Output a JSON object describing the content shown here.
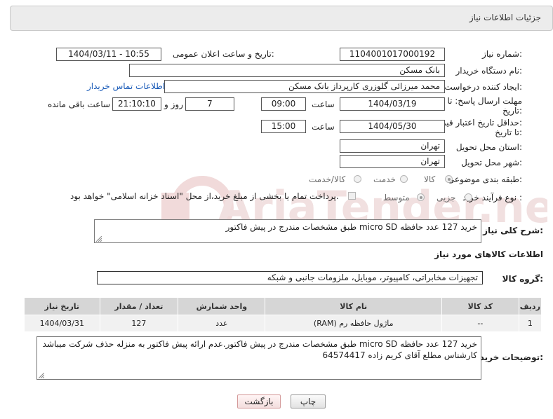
{
  "header": {
    "title": "جزئیات اطلاعات نیاز"
  },
  "fields": {
    "need_number_label": "شماره نیاز:",
    "need_number": "1104001017000192",
    "announce_label": "تاریخ و ساعت اعلان عمومی:",
    "announce_value": "1404/03/11 - 10:55",
    "buyer_org_label": "نام دستگاه خریدار:",
    "buyer_org": "بانک مسکن",
    "creator_label": "ایجاد کننده درخواست:",
    "creator": "محمد میرزائی گلوزری کارپرداز بانک مسکن",
    "contact_link": "اطلاعات تماس خریدار",
    "deadline_label_1": "مهلت ارسال پاسخ: تا",
    "deadline_label_2": "تاریخ:",
    "deadline_date": "1404/03/19",
    "time_word": "ساعت",
    "deadline_time": "09:00",
    "days_value": "7",
    "days_word": "روز و",
    "remaining_time": "21:10:10",
    "remaining_word": "ساعت باقی مانده",
    "validity_label_1": "حداقل تاریخ اعتبار قیمت:",
    "validity_label_2": "تا تاریخ:",
    "validity_date": "1404/05/30",
    "validity_time": "15:00",
    "province_label": "استان محل تحویل:",
    "province": "تهران",
    "city_label": "شهر محل تحویل:",
    "city": "تهران",
    "category_label": "طبقه بندی موضوعی:",
    "category_options": [
      "کالا",
      "خدمت",
      "کالا/خدمت"
    ],
    "process_label": "نوع فرآیند خرید :",
    "process_options": [
      "جزیی",
      "متوسط"
    ],
    "payment_note": "پرداخت تمام یا بخشی از مبلغ خرید،از محل \"اسناد خزانه اسلامی\" خواهد بود."
  },
  "description": {
    "label": "شرح کلی نیاز:",
    "text": "خرید 127 عدد حافظه micro SD طبق مشخصات مندرج در پیش فاکتور"
  },
  "goods_section": {
    "title": "اطلاعات کالاهای مورد نیاز",
    "group_label": "گروه کالا:",
    "group_value": "تجهیزات مخابراتی، کامپیوتر، موبایل، ملزومات جانبی و شبکه"
  },
  "table": {
    "headers": [
      "ردیف",
      "کد کالا",
      "نام کالا",
      "واحد شمارش",
      "تعداد / مقدار",
      "تاریخ نیاز"
    ],
    "rows": [
      [
        "1",
        "--",
        "ماژول حافظه رم (RAM)",
        "عدد",
        "127",
        "1404/03/31"
      ]
    ]
  },
  "buyer_notes": {
    "label": "توضیحات خریدار:",
    "text": "خرید 127 عدد حافظه micro SD طبق مشخصات مندرج در پیش فاکتور.عدم ارائه پیش فاکتور به منزله حذف شرکت میباشد کارشناس مطلع آقای کریم زاده 64574417"
  },
  "buttons": {
    "print": "چاپ",
    "back": "بازگشت"
  },
  "watermark": {
    "text": "AriaTender.neT"
  },
  "colors": {
    "link": "#1a5bb8",
    "header_bg": "#ececec",
    "table_header": "#d6d6d6",
    "watermark": "#f0d9d9"
  }
}
